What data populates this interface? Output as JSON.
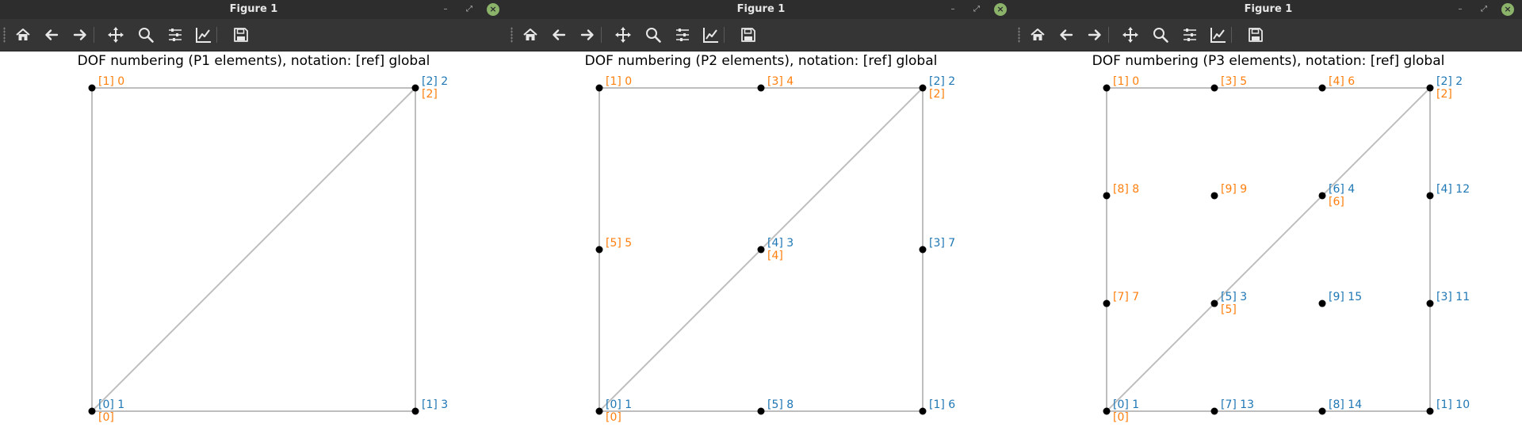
{
  "colors": {
    "blue": "#1f77b4",
    "orange": "#ff7f0e",
    "edge": "#bebebe",
    "node": "#000000"
  },
  "toolbar_icons": [
    "home-icon",
    "back-icon",
    "forward-icon",
    "pan-icon",
    "zoom-icon",
    "configure-subplots-icon",
    "edit-axes-icon",
    "save-icon"
  ],
  "windows": [
    {
      "title": "Figure 1",
      "plot_title": "DOF numbering (P1 elements), notation: [ref] global",
      "chart_data": {
        "type": "scatter",
        "element": "P1",
        "xlim": [
          0,
          1
        ],
        "ylim": [
          0,
          1
        ],
        "edges": [
          [
            [
              0,
              0
            ],
            [
              1,
              0
            ]
          ],
          [
            [
              1,
              0
            ],
            [
              1,
              1
            ]
          ],
          [
            [
              1,
              1
            ],
            [
              0,
              1
            ]
          ],
          [
            [
              0,
              1
            ],
            [
              0,
              0
            ]
          ],
          [
            [
              0,
              0
            ],
            [
              1,
              1
            ]
          ]
        ],
        "dofs": [
          {
            "x": 0,
            "y": 0,
            "labels": [
              {
                "text": "[0] 1",
                "color": "blue"
              },
              {
                "text": "[0]",
                "color": "orange"
              }
            ]
          },
          {
            "x": 1,
            "y": 0,
            "labels": [
              {
                "text": "[1] 3",
                "color": "blue"
              }
            ]
          },
          {
            "x": 1,
            "y": 1,
            "labels": [
              {
                "text": "[2] 2",
                "color": "blue"
              },
              {
                "text": "[2]",
                "color": "orange"
              }
            ]
          },
          {
            "x": 0,
            "y": 1,
            "labels": [
              {
                "text": "[1] 0",
                "color": "orange"
              }
            ]
          }
        ]
      }
    },
    {
      "title": "Figure 1",
      "plot_title": "DOF numbering (P2 elements), notation: [ref] global",
      "chart_data": {
        "type": "scatter",
        "element": "P2",
        "xlim": [
          0,
          1
        ],
        "ylim": [
          0,
          1
        ],
        "edges": [
          [
            [
              0,
              0
            ],
            [
              1,
              0
            ]
          ],
          [
            [
              1,
              0
            ],
            [
              1,
              1
            ]
          ],
          [
            [
              1,
              1
            ],
            [
              0,
              1
            ]
          ],
          [
            [
              0,
              1
            ],
            [
              0,
              0
            ]
          ],
          [
            [
              0,
              0
            ],
            [
              1,
              1
            ]
          ]
        ],
        "dofs": [
          {
            "x": 0,
            "y": 0,
            "labels": [
              {
                "text": "[0] 1",
                "color": "blue"
              },
              {
                "text": "[0]",
                "color": "orange"
              }
            ]
          },
          {
            "x": 0.5,
            "y": 0,
            "labels": [
              {
                "text": "[5] 8",
                "color": "blue"
              }
            ]
          },
          {
            "x": 1,
            "y": 0,
            "labels": [
              {
                "text": "[1] 6",
                "color": "blue"
              }
            ]
          },
          {
            "x": 1,
            "y": 0.5,
            "labels": [
              {
                "text": "[3] 7",
                "color": "blue"
              }
            ]
          },
          {
            "x": 1,
            "y": 1,
            "labels": [
              {
                "text": "[2] 2",
                "color": "blue"
              },
              {
                "text": "[2]",
                "color": "orange"
              }
            ]
          },
          {
            "x": 0.5,
            "y": 0.5,
            "labels": [
              {
                "text": "[4] 3",
                "color": "blue"
              },
              {
                "text": "[4]",
                "color": "orange"
              }
            ]
          },
          {
            "x": 0,
            "y": 1,
            "labels": [
              {
                "text": "[1] 0",
                "color": "orange"
              }
            ]
          },
          {
            "x": 0.5,
            "y": 1,
            "labels": [
              {
                "text": "[3] 4",
                "color": "orange"
              }
            ]
          },
          {
            "x": 0,
            "y": 0.5,
            "labels": [
              {
                "text": "[5] 5",
                "color": "orange"
              }
            ]
          }
        ]
      }
    },
    {
      "title": "Figure 1",
      "plot_title": "DOF numbering (P3 elements), notation: [ref] global",
      "chart_data": {
        "type": "scatter",
        "element": "P3",
        "xlim": [
          0,
          1
        ],
        "ylim": [
          0,
          1
        ],
        "edges": [
          [
            [
              0,
              0
            ],
            [
              1,
              0
            ]
          ],
          [
            [
              1,
              0
            ],
            [
              1,
              1
            ]
          ],
          [
            [
              1,
              1
            ],
            [
              0,
              1
            ]
          ],
          [
            [
              0,
              1
            ],
            [
              0,
              0
            ]
          ],
          [
            [
              0,
              0
            ],
            [
              1,
              1
            ]
          ]
        ],
        "dofs": [
          {
            "x": 0,
            "y": 0,
            "labels": [
              {
                "text": "[0] 1",
                "color": "blue"
              },
              {
                "text": "[0]",
                "color": "orange"
              }
            ]
          },
          {
            "x": 0.3333,
            "y": 0,
            "labels": [
              {
                "text": "[7] 13",
                "color": "blue"
              }
            ]
          },
          {
            "x": 0.6667,
            "y": 0,
            "labels": [
              {
                "text": "[8] 14",
                "color": "blue"
              }
            ]
          },
          {
            "x": 1,
            "y": 0,
            "labels": [
              {
                "text": "[1] 10",
                "color": "blue"
              }
            ]
          },
          {
            "x": 1,
            "y": 0.3333,
            "labels": [
              {
                "text": "[3] 11",
                "color": "blue"
              }
            ]
          },
          {
            "x": 1,
            "y": 0.6667,
            "labels": [
              {
                "text": "[4] 12",
                "color": "blue"
              }
            ]
          },
          {
            "x": 1,
            "y": 1,
            "labels": [
              {
                "text": "[2] 2",
                "color": "blue"
              },
              {
                "text": "[2]",
                "color": "orange"
              }
            ]
          },
          {
            "x": 0.3333,
            "y": 0.3333,
            "labels": [
              {
                "text": "[5] 3",
                "color": "blue"
              },
              {
                "text": "[5]",
                "color": "orange"
              }
            ]
          },
          {
            "x": 0.6667,
            "y": 0.6667,
            "labels": [
              {
                "text": "[6] 4",
                "color": "blue"
              },
              {
                "text": "[6]",
                "color": "orange"
              }
            ]
          },
          {
            "x": 0.6667,
            "y": 0.3333,
            "labels": [
              {
                "text": "[9] 15",
                "color": "blue"
              }
            ]
          },
          {
            "x": 0,
            "y": 1,
            "labels": [
              {
                "text": "[1] 0",
                "color": "orange"
              }
            ]
          },
          {
            "x": 0.3333,
            "y": 1,
            "labels": [
              {
                "text": "[3] 5",
                "color": "orange"
              }
            ]
          },
          {
            "x": 0.6667,
            "y": 1,
            "labels": [
              {
                "text": "[4] 6",
                "color": "orange"
              }
            ]
          },
          {
            "x": 0,
            "y": 0.6667,
            "labels": [
              {
                "text": "[8] 8",
                "color": "orange"
              }
            ]
          },
          {
            "x": 0,
            "y": 0.3333,
            "labels": [
              {
                "text": "[7] 7",
                "color": "orange"
              }
            ]
          },
          {
            "x": 0.3333,
            "y": 0.6667,
            "labels": [
              {
                "text": "[9] 9",
                "color": "orange"
              }
            ]
          }
        ]
      }
    }
  ]
}
